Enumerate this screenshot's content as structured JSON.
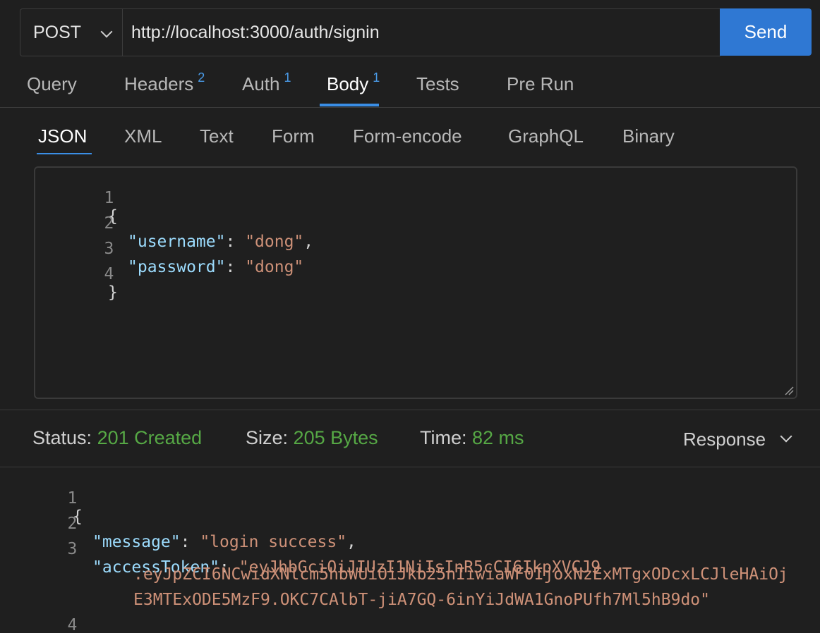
{
  "request": {
    "method": "POST",
    "url": "http://localhost:3000/auth/signin",
    "send_label": "Send"
  },
  "tabs": [
    {
      "label": "Query",
      "badge": ""
    },
    {
      "label": "Headers",
      "badge": "2"
    },
    {
      "label": "Auth",
      "badge": "1"
    },
    {
      "label": "Body",
      "badge": "1"
    },
    {
      "label": "Tests",
      "badge": ""
    },
    {
      "label": "Pre Run",
      "badge": ""
    }
  ],
  "active_tab": "Body",
  "body_tabs": [
    "JSON",
    "XML",
    "Text",
    "Form",
    "Form-encode",
    "GraphQL",
    "Binary"
  ],
  "active_body_tab": "JSON",
  "request_body": {
    "line_numbers": [
      "1",
      "2",
      "3",
      "4"
    ],
    "open_brace": "{",
    "close_brace": "}",
    "username_key": "\"username\"",
    "username_value": "\"dong\"",
    "password_key": "\"password\"",
    "password_value": "\"dong\""
  },
  "status": {
    "status_label": "Status:",
    "status_value": "201 Created",
    "size_label": "Size:",
    "size_value": "205 Bytes",
    "time_label": "Time:",
    "time_value": "82 ms",
    "response_dropdown": "Response"
  },
  "response_body": {
    "line_numbers": [
      "1",
      "2",
      "3",
      "4"
    ],
    "open_brace": "{",
    "close_brace": "}",
    "message_key": "\"message\"",
    "message_value": "\"login success\"",
    "token_key": "\"accessToken\"",
    "token_line1": "\"eyJhbGciOiJIUzI1NiIsInR5cCI6IkpXVCJ9",
    "token_line2": ".eyJpZCI6NCwidXNlcm5hbWUiOiJkb25nIiwiaWF0IjoxNzExMTgxODcxLCJleHAiOj",
    "token_line3": "E3MTExODE5MzF9.OKC7CAlbT-jiA7GQ-6inYiJdWA1GnoPUfh7Ml5hB9do\""
  },
  "colors": {
    "accent": "#2f78d3",
    "tab_underline": "#3a8ee6",
    "status_green": "#56a845",
    "json_key": "#9cdcfe",
    "json_string": "#ce9178"
  }
}
